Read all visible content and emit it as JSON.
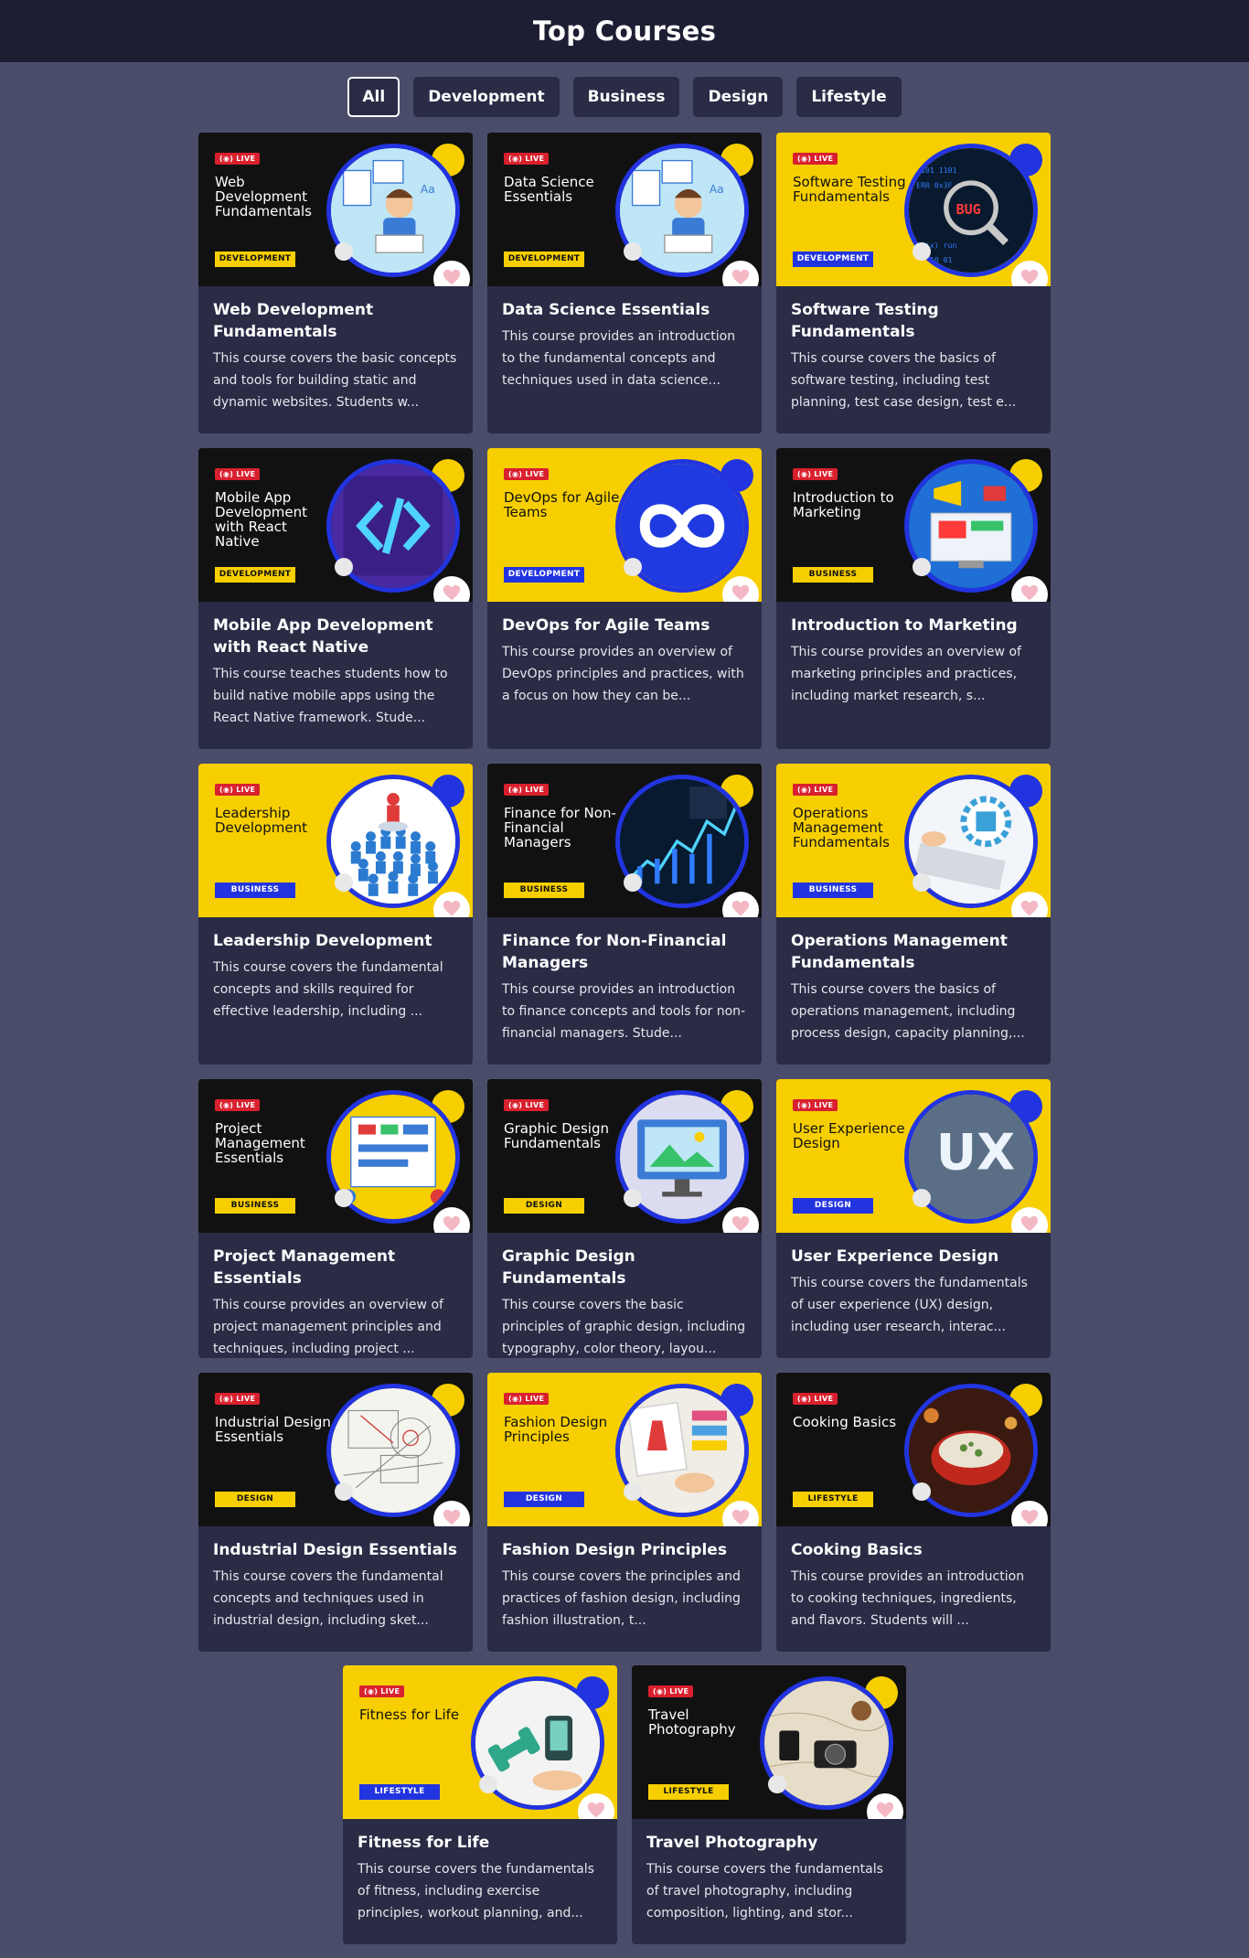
{
  "header": {
    "title": "Top Courses"
  },
  "filters": [
    {
      "label": "All",
      "active": true
    },
    {
      "label": "Development",
      "active": false
    },
    {
      "label": "Business",
      "active": false
    },
    {
      "label": "Design",
      "active": false
    },
    {
      "label": "Lifestyle",
      "active": false
    }
  ],
  "live_label": "LIVE",
  "courses": [
    {
      "thumb_title": "Web Development Fundamentals",
      "badge": "DEVELOPMENT",
      "theme": "dark",
      "art": "student-laptop",
      "title": "Web Development Fundamentals",
      "desc": "This course covers the basic concepts and tools for building static and dynamic websites. Students w..."
    },
    {
      "thumb_title": "Data Science Essentials",
      "badge": "DEVELOPMENT",
      "theme": "dark",
      "art": "student-laptop",
      "title": "Data Science Essentials",
      "desc": "This course provides an introduction to the fundamental concepts and techniques used in data science..."
    },
    {
      "thumb_title": "Software Testing Fundamentals",
      "badge": "DEVELOPMENT",
      "theme": "yellow",
      "art": "bug-magnifier",
      "title": "Software Testing Fundamentals",
      "desc": "This course covers the basics of software testing, including test planning, test case design, test e..."
    },
    {
      "thumb_title": "Mobile App Development with React Native",
      "badge": "DEVELOPMENT",
      "theme": "dark",
      "art": "code-brackets",
      "title": "Mobile App Development with React Native",
      "desc": "This course teaches students how to build native mobile apps using the React Native framework. Stude..."
    },
    {
      "thumb_title": "DevOps for Agile Teams",
      "badge": "DEVELOPMENT",
      "theme": "yellow",
      "art": "infinity-loop",
      "title": "DevOps for Agile Teams",
      "desc": "This course provides an overview of DevOps principles and practices, with a focus on how they can be..."
    },
    {
      "thumb_title": "Introduction to Marketing",
      "badge": "BUSINESS",
      "theme": "dark",
      "art": "marketing-screen",
      "title": "Introduction to Marketing",
      "desc": "This course provides an overview of marketing principles and practices, including market research, s..."
    },
    {
      "thumb_title": "Leadership Development",
      "badge": "BUSINESS",
      "theme": "yellow",
      "art": "leader-crowd",
      "title": "Leadership Development",
      "desc": "This course covers the fundamental concepts and skills required for effective leadership, including ..."
    },
    {
      "thumb_title": "Finance for Non-Financial Managers",
      "badge": "BUSINESS",
      "theme": "dark",
      "art": "finance-chart",
      "title": "Finance for Non-Financial Managers",
      "desc": "This course provides an introduction to finance concepts and tools for non-financial managers. Stude..."
    },
    {
      "thumb_title": "Operations Management Fundamentals",
      "badge": "BUSINESS",
      "theme": "yellow",
      "art": "gears-keyboard",
      "title": "Operations Management Fundamentals",
      "desc": "This course covers the basics of operations management, including process design, capacity planning,..."
    },
    {
      "thumb_title": "Project Management Essentials",
      "badge": "BUSINESS",
      "theme": "dark",
      "art": "project-board",
      "title": "Project Management Essentials",
      "desc": "This course provides an overview of project management principles and techniques, including project ..."
    },
    {
      "thumb_title": "Graphic Design Fundamentals",
      "badge": "DESIGN",
      "theme": "dark",
      "art": "monitor-image",
      "title": "Graphic Design Fundamentals",
      "desc": "This course covers the basic principles of graphic design, including typography, color theory, layou..."
    },
    {
      "thumb_title": "User Experience Design",
      "badge": "DESIGN",
      "theme": "yellow",
      "art": "ux-text",
      "art_text": "UX",
      "title": "User Experience Design",
      "desc": "This course covers the fundamentals of user experience (UX) design, including user research, interac..."
    },
    {
      "thumb_title": "Industrial Design Essentials",
      "badge": "DESIGN",
      "theme": "dark",
      "art": "technical-drawing",
      "title": "Industrial Design Essentials",
      "desc": "This course covers the fundamental concepts and techniques used in industrial design, including sket..."
    },
    {
      "thumb_title": "Fashion Design Principles",
      "badge": "DESIGN",
      "theme": "yellow",
      "art": "fashion-swatches",
      "title": "Fashion Design Principles",
      "desc": "This course covers the principles and practices of fashion design, including fashion illustration, t..."
    },
    {
      "thumb_title": "Cooking Basics",
      "badge": "LIFESTYLE",
      "theme": "dark",
      "art": "cooking-pot",
      "title": "Cooking Basics",
      "desc": "This course provides an introduction to cooking techniques, ingredients, and flavors. Students will ..."
    },
    {
      "thumb_title": "Fitness for Life",
      "badge": "LIFESTYLE",
      "theme": "yellow",
      "art": "dumbbells",
      "title": "Fitness for Life",
      "desc": "This course covers the fundamentals of fitness, including exercise principles, workout planning, and..."
    },
    {
      "thumb_title": "Travel Photography",
      "badge": "LIFESTYLE",
      "theme": "dark",
      "art": "camera-map",
      "title": "Travel Photography",
      "desc": "This course covers the fundamentals of travel photography, including composition, lighting, and stor..."
    }
  ],
  "colors": {
    "page_bg": "#4a4d6a",
    "header_bg": "#1d1e33",
    "card_bg": "#2a2b45",
    "accent_yellow": "#f7cf00",
    "accent_blue": "#2234e0",
    "live_red": "#d9202e",
    "heart_pink": "#f4b8c4"
  },
  "icons": {
    "favorite": "heart-icon",
    "live": "broadcast-icon"
  }
}
